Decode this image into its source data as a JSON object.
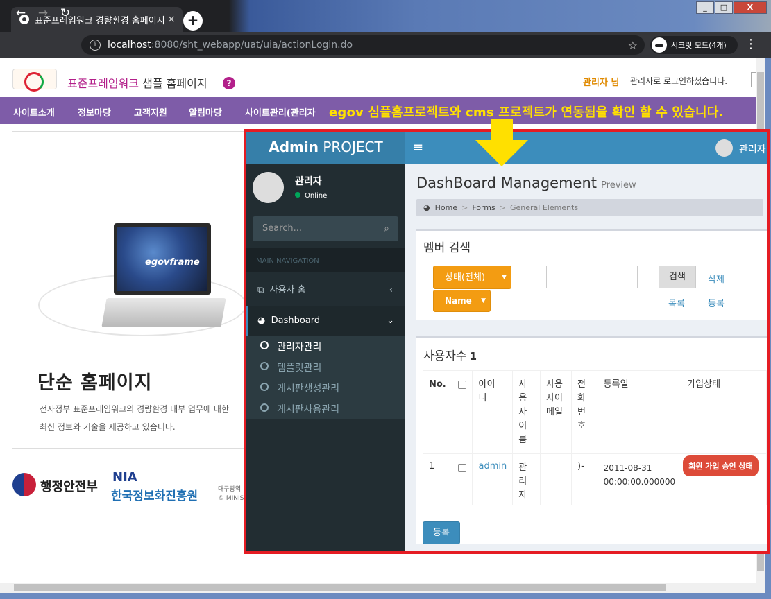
{
  "browser": {
    "tab_title": "표준프레임워크 경량환경 홈페이지",
    "tab_close": "×",
    "new_tab": "+",
    "back": "←",
    "forward": "→",
    "reload": "↻",
    "url_host": "localhost",
    "url_path": ":8080/sht_webapp/uat/uia/actionLogin.do",
    "incognito_label": "시크릿 모드(4개)",
    "star": "☆",
    "menu": "⋮",
    "window_buttons": [
      "_",
      "□",
      "X"
    ]
  },
  "site": {
    "title_accent": "표준프레임워크",
    "title_rest": " 샘플 홈페이지",
    "help": "?",
    "admin_name": "관리자 님",
    "admin_msg": "관리자로 로그인하셨습니다.",
    "menu": [
      "사이트소개",
      "정보마당",
      "고객지원",
      "알림마당",
      "사이트관리(관리자"
    ],
    "banner": "egov 심플홈프로젝트와 cms 프로젝트가 연동됨을 확인 할 수 있습니다.",
    "laptop_label": "egovframe",
    "simple_title": "단순 홈페이지",
    "simple_desc1": "전자정부 표준프레임워크의 경량환경 내부 업무에 대한",
    "simple_desc2": "최신 정보와 기술을 제공하고 있습니다.",
    "footer_mois": "행정안전부",
    "footer_nia": "NIA",
    "footer_nia2": "한국정보화진흥원",
    "footer_addr1": "대구광역",
    "footer_addr2": "© MINIST"
  },
  "admin": {
    "logo_bold": "Admin",
    "logo_rest": " PROJECT",
    "burger": "≡",
    "top_user": "관리자",
    "user_name": "관리자",
    "user_status": "Online",
    "search_placeholder": "Search...",
    "search_icon": "⌕",
    "nav_header": "MAIN NAVIGATION",
    "nav_home": "사용자 홈",
    "nav_dashboard": "Dashboard",
    "chev_left": "‹",
    "chev_down": "⌄",
    "sub_items": [
      "관리자관리",
      "템플릿관리",
      "게시판생성관리",
      "게시판사용관리"
    ],
    "page_title": "DashBoard Management",
    "page_subtitle": "Preview",
    "breadcrumb": [
      "Home",
      "Forms",
      "General Elements"
    ],
    "breadcrumb_sep": ">",
    "search_box_title": "멤버 검색",
    "status_select": "상태(전체)",
    "name_select": "Name",
    "caret": "▼",
    "search_btn": "검색",
    "delete_link": "삭제",
    "list_link": "목록",
    "register_link": "등록",
    "users_title": "사용자수",
    "users_count": "1",
    "table_headers": [
      "No.",
      "",
      "아이디",
      "사용자이름",
      "사용자이메일",
      "전화번호",
      "등록일",
      "가입상태"
    ],
    "row": {
      "no": "1",
      "id": "admin",
      "name": "관리자",
      "email": "",
      "phone": ")-",
      "date": "2011-08-31 00:00:00.000000",
      "status": "회원 가입 승인 상태"
    },
    "register_btn": "등록"
  },
  "colors": {
    "menubar": "#7e5ca8",
    "banner": "#ffe000",
    "admin_header": "#3c8dbc",
    "sidebar": "#222d32",
    "warning": "#f39c12",
    "danger": "#dd4b39",
    "frame": "#e51c23"
  }
}
